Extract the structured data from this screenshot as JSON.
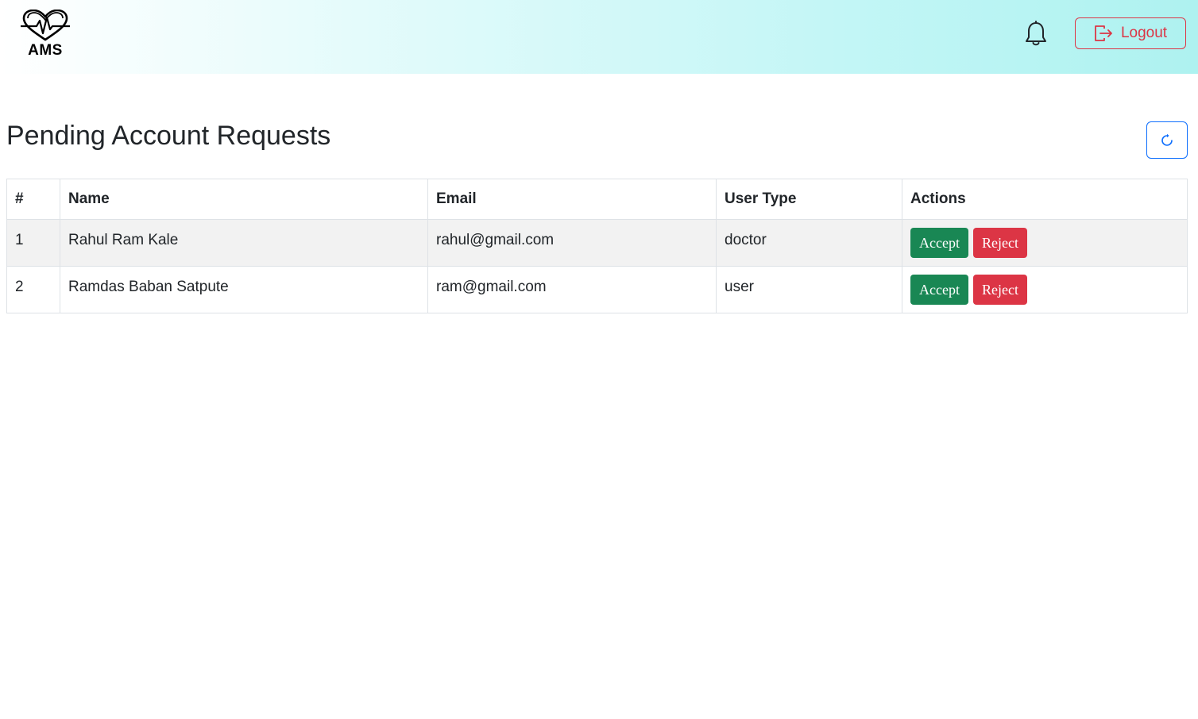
{
  "navbar": {
    "brand_text": "AMS",
    "logout_label": "Logout"
  },
  "page": {
    "title": "Pending Account Requests"
  },
  "table": {
    "headers": [
      "#",
      "Name",
      "Email",
      "User Type",
      "Actions"
    ],
    "rows": [
      {
        "num": "1",
        "name": "Rahul Ram Kale",
        "email": "rahul@gmail.com",
        "user_type": "doctor",
        "accept": "Accept",
        "reject": "Reject"
      },
      {
        "num": "2",
        "name": "Ramdas Baban Satpute",
        "email": "ram@gmail.com",
        "user_type": "user",
        "accept": "Accept",
        "reject": "Reject"
      }
    ]
  },
  "colors": {
    "accept": "#198754",
    "reject": "#dc3545",
    "primary": "#0d6efd"
  },
  "icons": {
    "brand": "heart-pulse-icon",
    "notifications": "bell-icon",
    "logout": "box-arrow-right-icon",
    "refresh": "refresh-icon"
  }
}
